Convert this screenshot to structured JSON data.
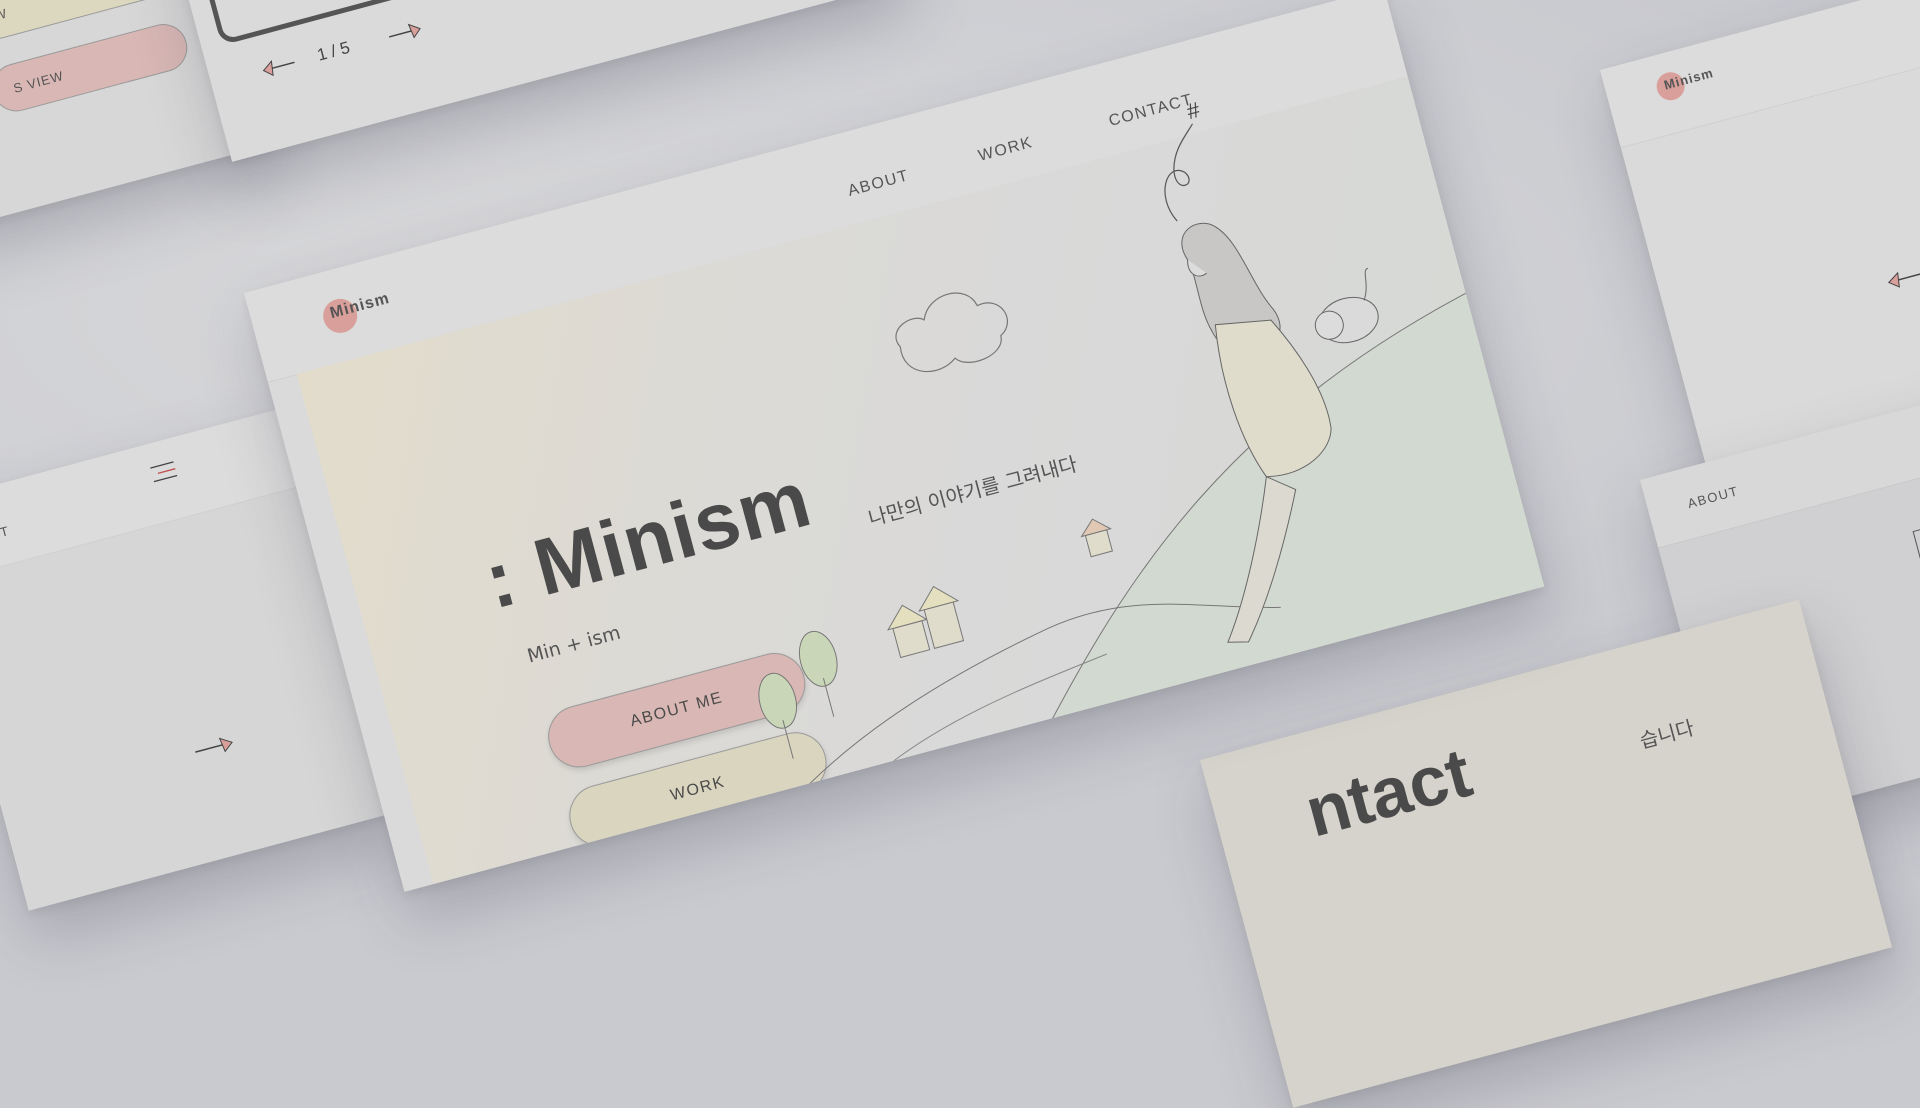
{
  "brand": {
    "logo_text": "Minism",
    "logo_dot_color": "#d99f9b"
  },
  "nav": {
    "about": "ABOUT",
    "work": "WORK",
    "contact": "CONTACT"
  },
  "hero": {
    "title": ": Minism",
    "subtitle_korean": "나만의 이야기를 그려내다",
    "tagline": "Min + ism",
    "button_about": "ABOUT ME",
    "button_work": "WORK"
  },
  "pager": {
    "text": "1 / 5"
  },
  "side_cards": {
    "left_nav_contact": "NTACT",
    "top_left_pill_2": "S VIEW",
    "top_left_pill_1": "W",
    "right_nav_about": "ABOUT",
    "contact_title": "ntact",
    "contact_sub": "습니다"
  },
  "colors": {
    "rose": "#d8b7b4",
    "sand": "#d9d5bf",
    "sage": "#d2d9d0",
    "text": "#4a4a4a"
  }
}
